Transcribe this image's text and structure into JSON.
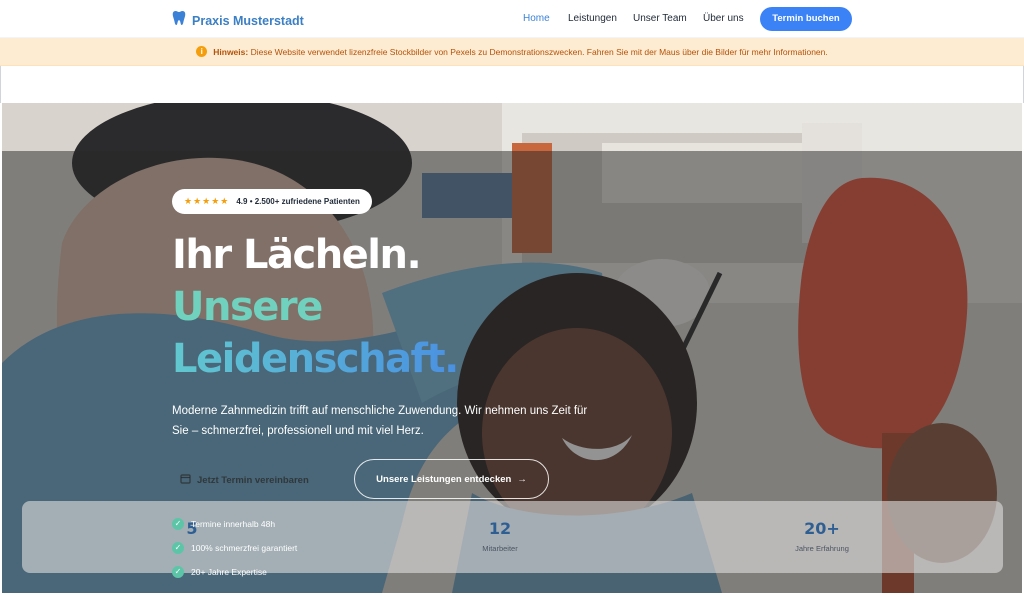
{
  "header": {
    "logo_text": "Praxis Musterstadt",
    "logo_icon": "tooth-icon",
    "nav": [
      {
        "label": "Home",
        "active": true
      },
      {
        "label": "Leistungen",
        "active": false
      },
      {
        "label": "Unser Team",
        "active": false
      },
      {
        "label": "Über uns",
        "active": false
      }
    ],
    "cta_label": "Termin buchen"
  },
  "notice": {
    "icon": "info-icon",
    "label": "Hinweis:",
    "text": "Diese Website verwendet lizenzfreie Stockbilder von Pexels zu Demonstrationszwecken. Fahren Sie mit der Maus über die Bilder für mehr Informationen."
  },
  "hero": {
    "rating": {
      "stars": "★★★★★",
      "text": "4.9 • 2.500+ zufriedene Patienten"
    },
    "headline_1": "Ihr Lächeln.",
    "headline_2": "Unsere",
    "headline_3": "Leidenschaft.",
    "subtitle": "Moderne Zahnmedizin trifft auf menschliche Zuwendung. Wir nehmen uns Zeit für Sie – schmerzfrei, professionell und mit viel Herz.",
    "primary_button": "Jetzt Termin vereinbaren",
    "secondary_button": "Unsere Leistungen entdecken",
    "secondary_arrow": "→"
  },
  "stats": [
    {
      "value": "5",
      "label": ""
    },
    {
      "value": "12",
      "label": "Mitarbeiter"
    },
    {
      "value": "20+",
      "label": "Jahre Erfahrung"
    }
  ],
  "checks": [
    "Termine innerhalb 48h",
    "100% schmerzfrei garantiert",
    "20+ Jahre Expertise"
  ],
  "colors": {
    "brand": "#3b82f6",
    "teal": "#6fd1be",
    "notice_bg": "#fdebd2",
    "star": "#f59e0b"
  }
}
